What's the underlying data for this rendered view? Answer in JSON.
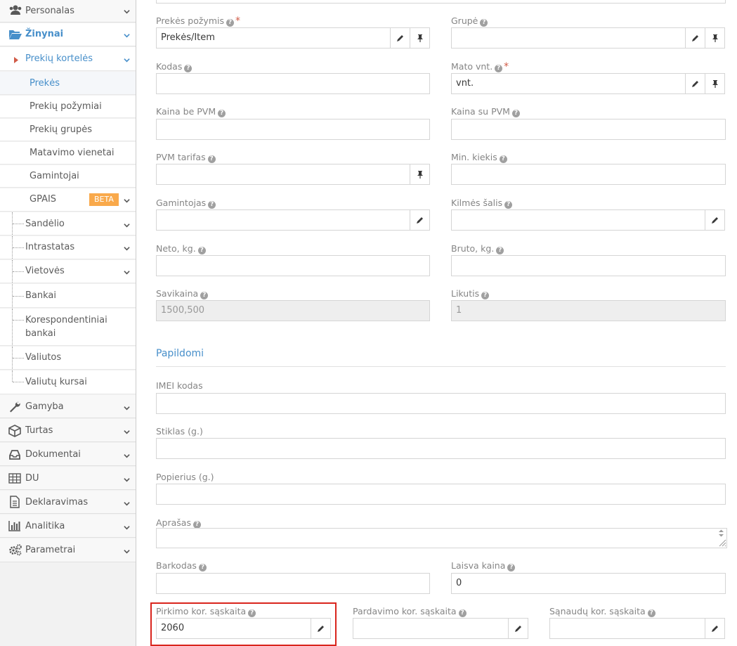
{
  "sidebar": {
    "items": [
      {
        "label": "Personalas",
        "icon": "users-icon"
      },
      {
        "label": "Žinynai",
        "icon": "folder-open-icon"
      },
      {
        "label": "Prekių kortelės"
      },
      {
        "label": "Prekės"
      },
      {
        "label": "Prekių požymiai"
      },
      {
        "label": "Prekių grupės"
      },
      {
        "label": "Matavimo vienetai"
      },
      {
        "label": "Gamintojai"
      },
      {
        "label": "GPAIS",
        "badge": "BETA"
      },
      {
        "label": "Sandėlio"
      },
      {
        "label": "Intrastatas"
      },
      {
        "label": "Vietovės"
      },
      {
        "label": "Bankai"
      },
      {
        "label": "Korespondentiniai bankai"
      },
      {
        "label": "Valiutos"
      },
      {
        "label": "Valiutų kursai"
      },
      {
        "label": "Gamyba",
        "icon": "wrench-icon"
      },
      {
        "label": "Turtas",
        "icon": "cube-icon"
      },
      {
        "label": "Dokumentai",
        "icon": "inbox-icon"
      },
      {
        "label": "DU",
        "icon": "table-icon"
      },
      {
        "label": "Deklaravimas",
        "icon": "file-text-icon"
      },
      {
        "label": "Analitika",
        "icon": "bar-chart-icon"
      },
      {
        "label": "Parametrai",
        "icon": "cogs-icon"
      }
    ]
  },
  "form": {
    "prekes_pozymis": {
      "label": "Prekės požymis",
      "value": "Prekės/Item"
    },
    "grupe": {
      "label": "Grupė",
      "value": ""
    },
    "kodas": {
      "label": "Kodas",
      "value": ""
    },
    "mato_vnt": {
      "label": "Mato vnt.",
      "value": "vnt."
    },
    "kaina_be_pvm": {
      "label": "Kaina be PVM",
      "value": ""
    },
    "kaina_su_pvm": {
      "label": "Kaina su PVM",
      "value": ""
    },
    "pvm_tarifas": {
      "label": "PVM tarifas",
      "value": ""
    },
    "min_kiekis": {
      "label": "Min. kiekis",
      "value": ""
    },
    "gamintojas": {
      "label": "Gamintojas",
      "value": ""
    },
    "kilmes_salis": {
      "label": "Kilmės šalis",
      "value": ""
    },
    "neto": {
      "label": "Neto, kg.",
      "value": ""
    },
    "bruto": {
      "label": "Bruto, kg.",
      "value": ""
    },
    "savikaina": {
      "label": "Savikaina",
      "value": "1500,500"
    },
    "likutis": {
      "label": "Likutis",
      "value": "1"
    },
    "section_papildomi": "Papildomi",
    "imei": {
      "label": "IMEI kodas",
      "value": ""
    },
    "stiklas": {
      "label": "Stiklas (g.)",
      "value": ""
    },
    "popierius": {
      "label": "Popierius (g.)",
      "value": ""
    },
    "aprasas": {
      "label": "Aprašas",
      "value": ""
    },
    "barkodas": {
      "label": "Barkodas",
      "value": ""
    },
    "laisva_kaina": {
      "label": "Laisva kaina",
      "value": "0"
    },
    "pirkimo": {
      "label": "Pirkimo kor. sąskaita",
      "value": "2060"
    },
    "pardavimo": {
      "label": "Pardavimo kor. sąskaita",
      "value": ""
    },
    "sanaudu": {
      "label": "Sąnaudų kor. sąskaita",
      "value": ""
    }
  },
  "colors": {
    "accent": "#478fca",
    "required": "#d15b47",
    "badge": "#f9a94b",
    "highlight": "#d9251d"
  }
}
